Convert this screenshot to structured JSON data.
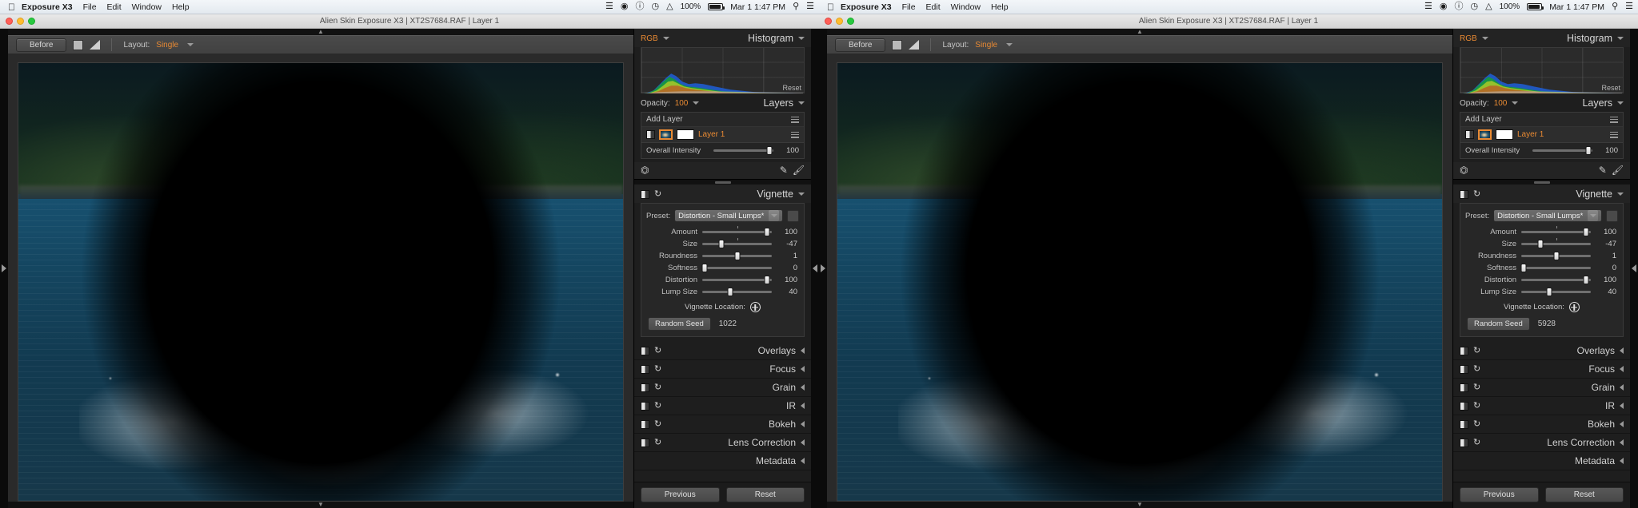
{
  "menubar": {
    "apple_icon": "apple-icon",
    "app_name": "Exposure X3",
    "items": [
      "File",
      "Edit",
      "Window",
      "Help"
    ],
    "status_icons": [
      "dropbox-icon",
      "eye-icon",
      "info-icon",
      "timemachine-icon",
      "wifi-icon"
    ],
    "battery_percent": "100%",
    "clock": "Mar 1  1:47 PM",
    "search_icon": "search-icon",
    "list_icon": "notification-center-icon"
  },
  "titlebar": {
    "title": "Alien Skin Exposure X3 | XT2S7684.RAF | Layer 1",
    "close": "close-button",
    "minimize": "minimize-button",
    "maximize": "maximize-button"
  },
  "toolbar": {
    "before_label": "Before",
    "swatch_icon": "split-view-icon",
    "wedge_icon": "gradient-wedge-icon",
    "layout_label": "Layout:",
    "layout_value": "Single"
  },
  "histogram": {
    "channel": "RGB",
    "title": "Histogram",
    "reset_label": "Reset"
  },
  "layers": {
    "opacity_label": "Opacity:",
    "opacity_value": "100",
    "title": "Layers",
    "add_layer_label": "Add Layer",
    "layer_name": "Layer 1",
    "intensity_label": "Overall Intensity",
    "intensity_value": "100",
    "crop_icon": "crop-icon",
    "eyedropper_icon": "eyedropper-icon",
    "brush_icon": "brush-icon"
  },
  "vignette": {
    "title": "Vignette",
    "preset_label": "Preset:",
    "preset_value": "Distortion - Small Lumps*",
    "sliders": [
      {
        "label": "Amount",
        "value": "100",
        "pos": 93
      },
      {
        "label": "Size",
        "value": "-47",
        "pos": 28
      },
      {
        "label": "Roundness",
        "value": "1",
        "pos": 50
      },
      {
        "label": "Softness",
        "value": "0",
        "pos": 3
      },
      {
        "label": "Distortion",
        "value": "100",
        "pos": 93
      },
      {
        "label": "Lump Size",
        "value": "40",
        "pos": 40
      }
    ],
    "location_label": "Vignette Location:",
    "location_icon": "target-crosshair-icon",
    "random_seed_label": "Random Seed",
    "random_seed_value": "1022",
    "random_seed_value_right": "5928"
  },
  "collapsed_panels": [
    {
      "label": "Overlays"
    },
    {
      "label": "Focus"
    },
    {
      "label": "Grain"
    },
    {
      "label": "IR"
    },
    {
      "label": "Bokeh"
    },
    {
      "label": "Lens Correction"
    }
  ],
  "metadata_panel": {
    "label": "Metadata"
  },
  "footer": {
    "previous_label": "Previous",
    "reset_label": "Reset"
  },
  "colors": {
    "accent_orange": "#e98a33",
    "panel_bg": "#1e1e1e",
    "toolbar_bg": "#4a4a4a"
  }
}
